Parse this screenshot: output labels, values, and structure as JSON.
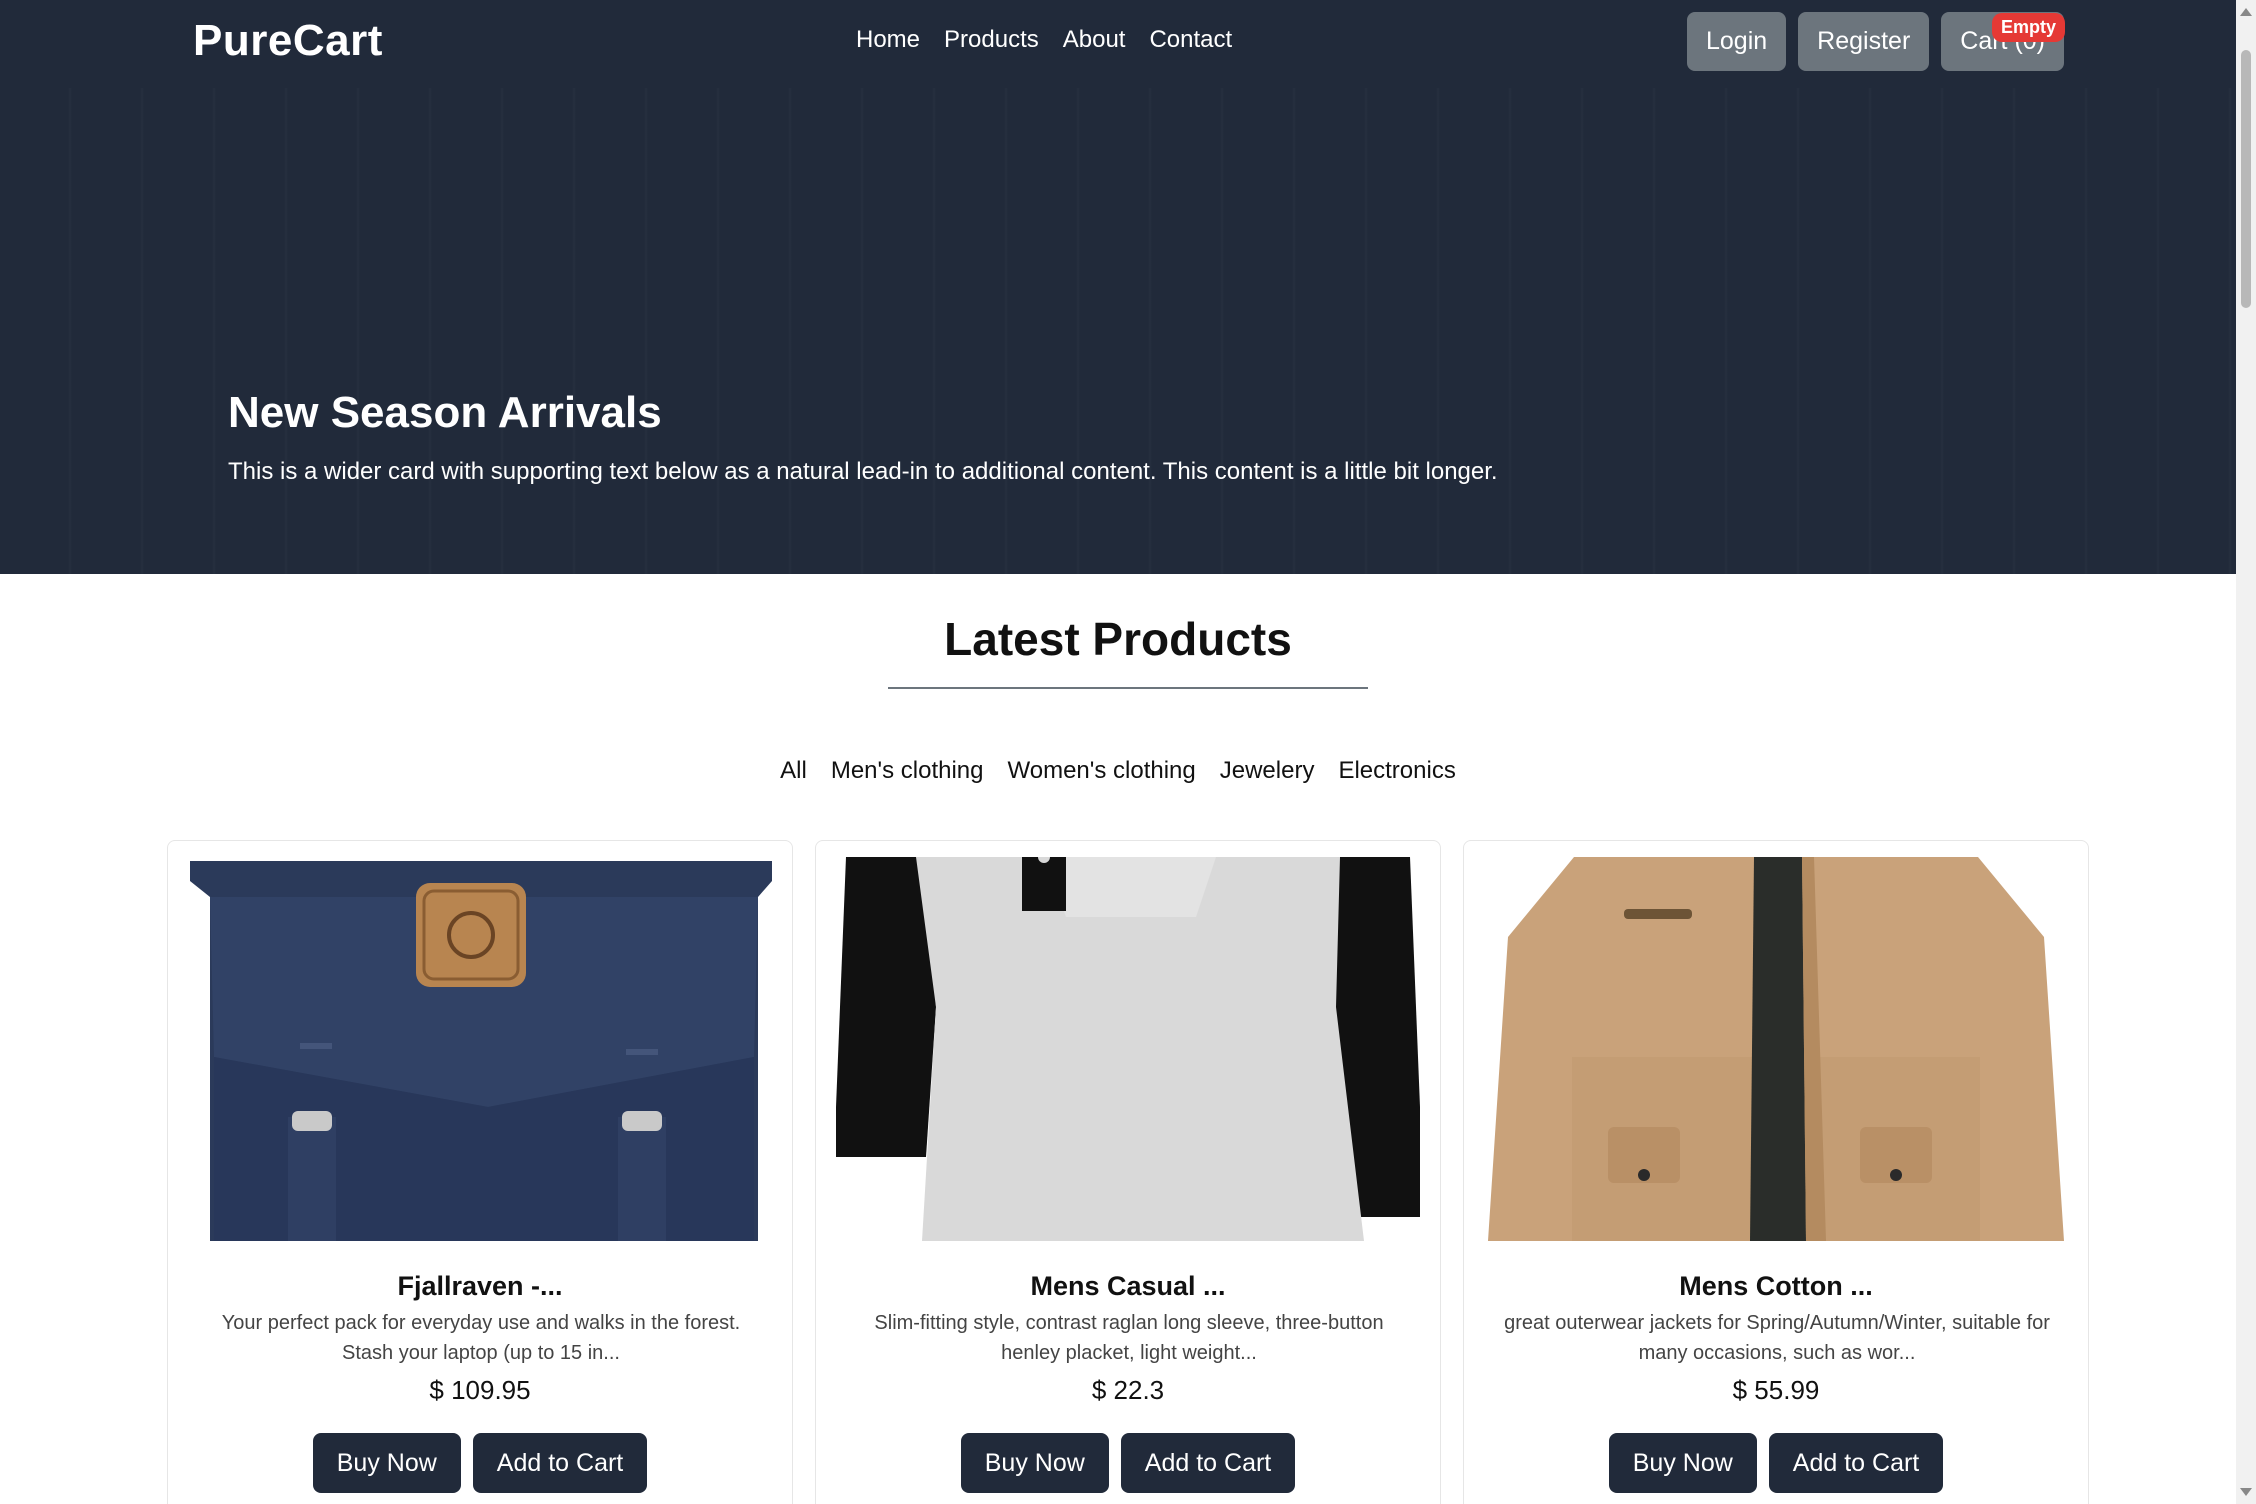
{
  "navbar": {
    "brand": "PureCart",
    "links": [
      "Home",
      "Products",
      "About",
      "Contact"
    ],
    "login_label": "Login",
    "register_label": "Register",
    "cart_label": "Cart (0)",
    "cart_badge": "Empty"
  },
  "hero": {
    "title": "New Season Arrivals",
    "text": "This is a wider card with supporting text below as a natural lead-in to additional content. This content is a little bit longer."
  },
  "products_section": {
    "title": "Latest Products",
    "filters": [
      "All",
      "Men's clothing",
      "Women's clothing",
      "Jewelery",
      "Electronics"
    ]
  },
  "products": [
    {
      "title": "Fjallraven -...",
      "description": "Your perfect pack for everyday use and walks in the forest. Stash your laptop (up to 15 in...",
      "price": "$ 109.95",
      "buy_label": "Buy Now",
      "cart_label": "Add to Cart",
      "image_icon": "backpack-image"
    },
    {
      "title": "Mens Casual ...",
      "description": "Slim-fitting style, contrast raglan long sleeve, three-button henley placket, light weight...",
      "price": "$ 22.3",
      "buy_label": "Buy Now",
      "cart_label": "Add to Cart",
      "image_icon": "tshirt-image"
    },
    {
      "title": "Mens Cotton ...",
      "description": "great outerwear jackets for Spring/Autumn/Winter, suitable for many occasions, such as wor...",
      "price": "$ 55.99",
      "buy_label": "Buy Now",
      "cart_label": "Add to Cart",
      "image_icon": "jacket-image"
    }
  ],
  "colors": {
    "dark": "#212a3a",
    "secondary": "#6c757d",
    "badge": "#e53935"
  }
}
